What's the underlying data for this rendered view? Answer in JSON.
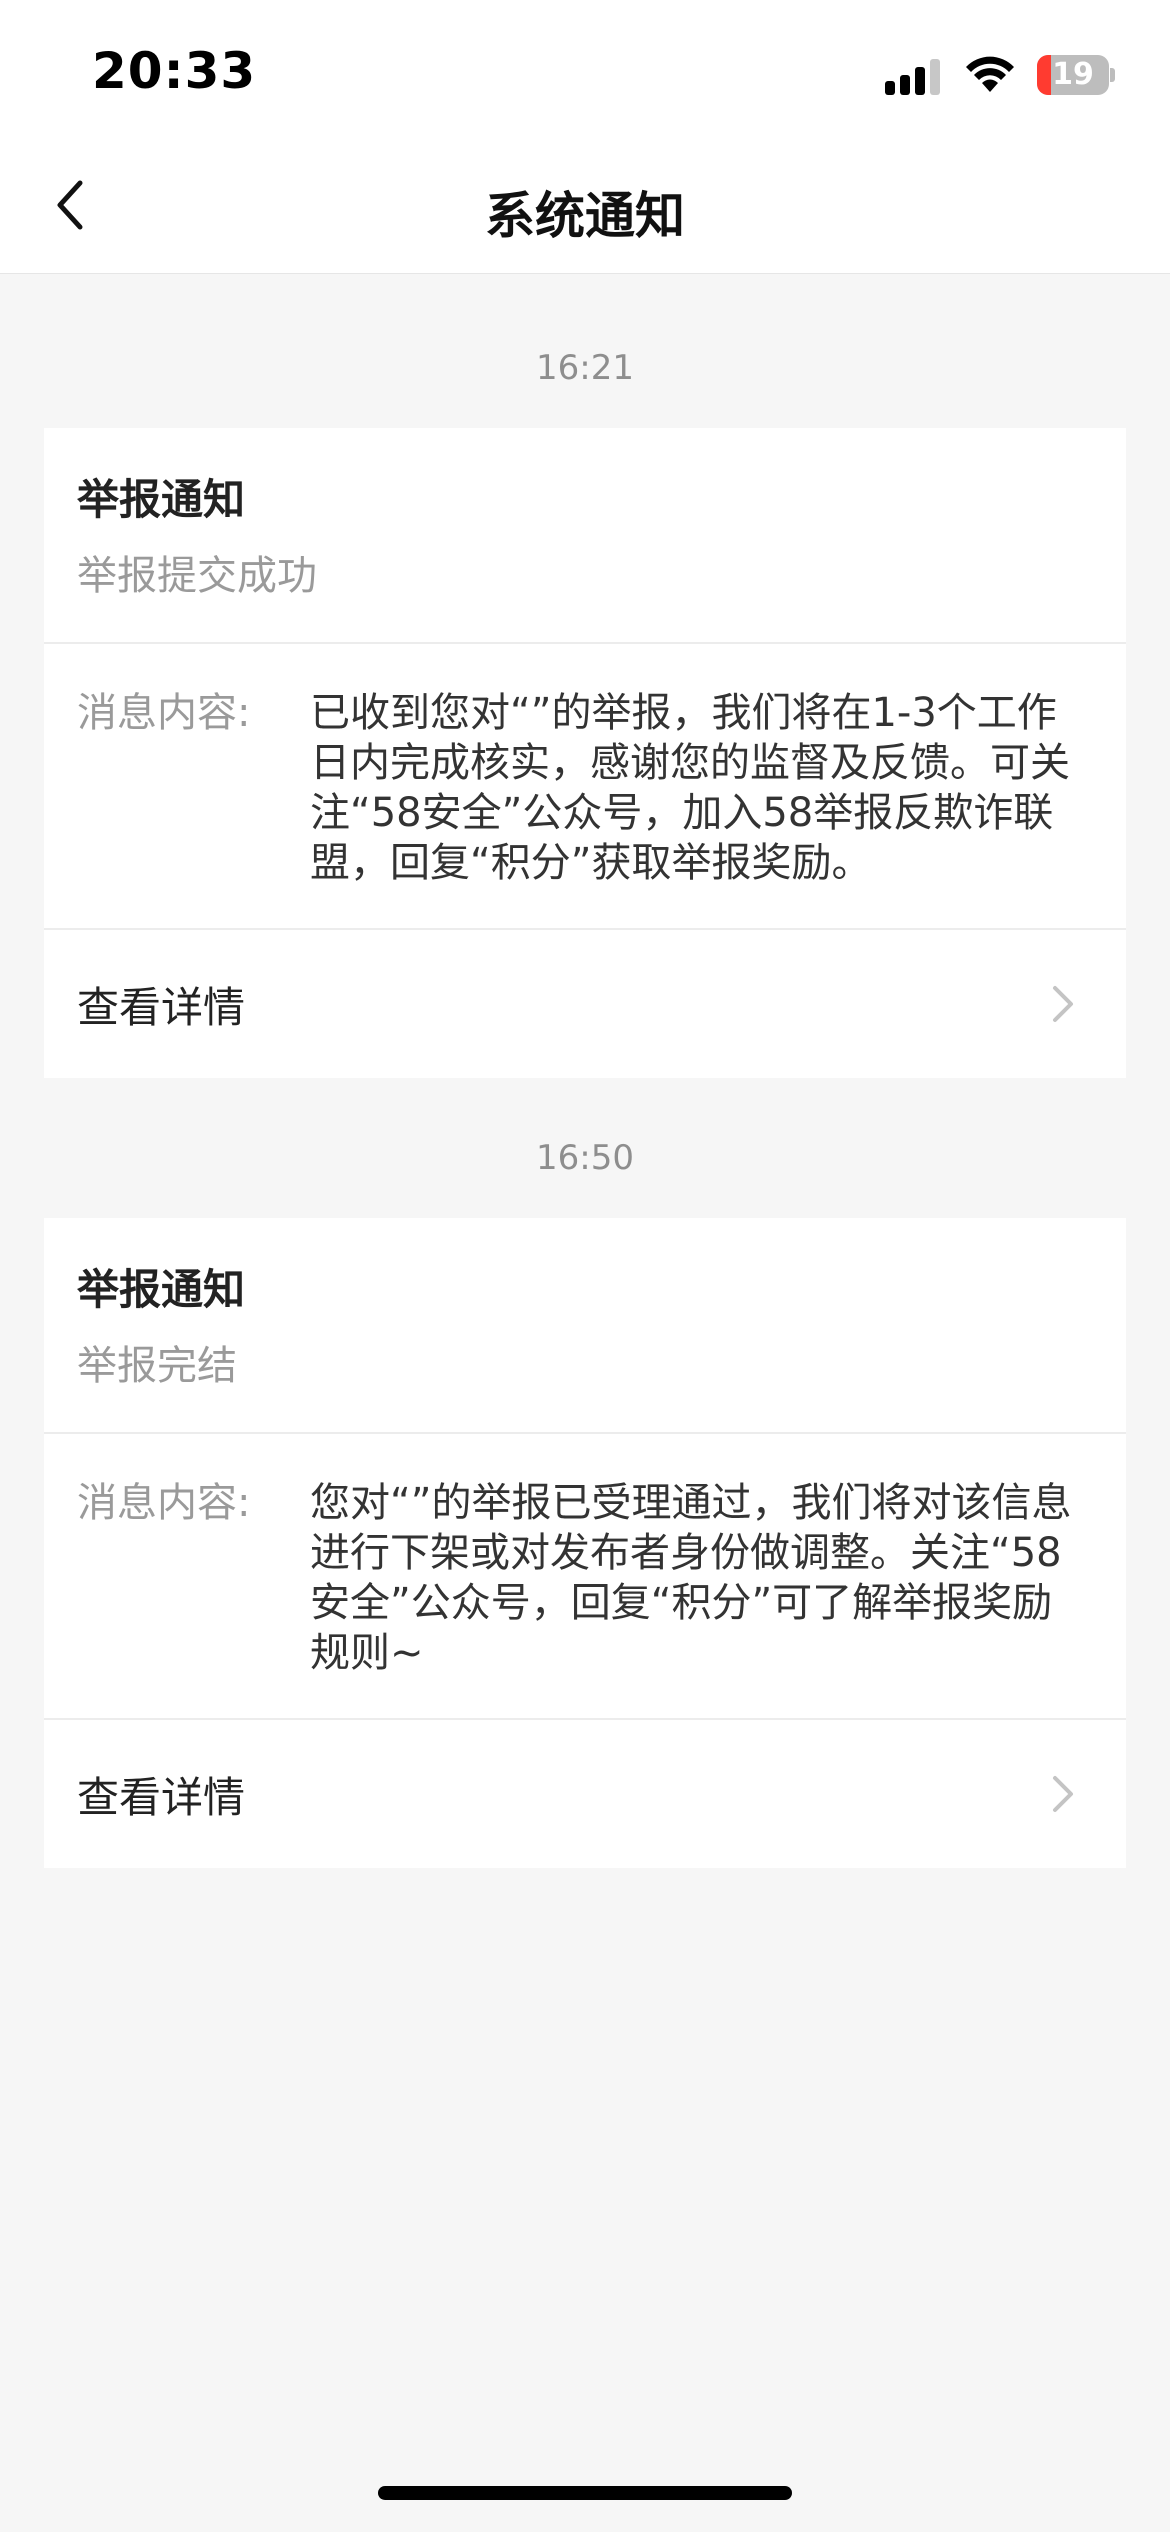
{
  "status_bar": {
    "time": "20:33",
    "battery_text": "19",
    "battery_level_percent": 19,
    "signal_icon": "cellular-signal-icon",
    "wifi_icon": "wifi-icon"
  },
  "nav": {
    "title": "系统通知",
    "back_icon": "chevron-left-icon"
  },
  "notifications": [
    {
      "time": "16:21",
      "title": "举报通知",
      "subtitle": "举报提交成功",
      "content_label": "消息内容:",
      "content": "已收到您对“”的举报，我们将在1-3个工作日内完成核实，感谢您的监督及反馈。可关注“58安全”公众号，加入58举报反欺诈联盟，回复“积分”获取举报奖励。",
      "action_label": "查看详情"
    },
    {
      "time": "16:50",
      "title": "举报通知",
      "subtitle": "举报完结",
      "content_label": "消息内容:",
      "content": "您对“”的举报已受理通过，我们将对该信息进行下架或对发布者身份做调整。关注“58安全”公众号，回复“积分”可了解举报奖励规则~",
      "action_label": "查看详情"
    }
  ],
  "colors": {
    "background": "#f6f6f6",
    "card": "#ffffff",
    "secondary_text": "#9a9a9a",
    "battery_low": "#ff3b30"
  }
}
